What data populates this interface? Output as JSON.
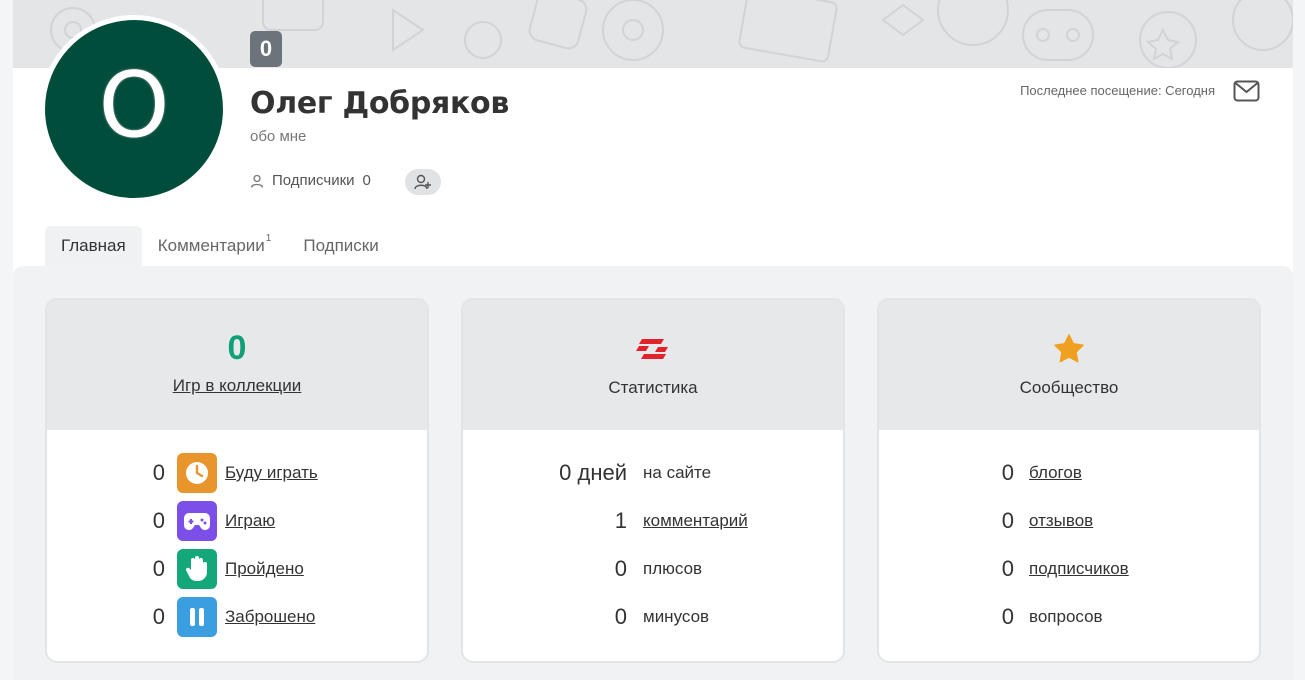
{
  "profile": {
    "avatar_letter": "O",
    "level": "0",
    "name": "Олег Добряков",
    "about": "обо мне",
    "followers_label": "Подписчики",
    "followers_count": "0",
    "last_visit": "Последнее посещение: Сегодня"
  },
  "tabs": [
    {
      "label": "Главная",
      "sup": ""
    },
    {
      "label": "Комментарии",
      "sup": "1"
    },
    {
      "label": "Подписки",
      "sup": ""
    }
  ],
  "collection": {
    "total": "0",
    "title": "Игр в коллекции",
    "items": [
      {
        "count": "0",
        "label": "Буду играть",
        "icon": "clock-icon",
        "color": "#e8962c"
      },
      {
        "count": "0",
        "label": "Играю",
        "icon": "gamepad-icon",
        "color": "#7b4fe8"
      },
      {
        "count": "0",
        "label": "Пройдено",
        "icon": "hand-icon",
        "color": "#14a77a"
      },
      {
        "count": "0",
        "label": "Заброшено",
        "icon": "pause-icon",
        "color": "#3a9ee0"
      }
    ]
  },
  "stats": {
    "title": "Статистика",
    "icon": "stopgame-logo-icon",
    "items": [
      {
        "count": "0 дней",
        "label": "на сайте"
      },
      {
        "count": "1",
        "label": "комментарий"
      },
      {
        "count": "0",
        "label": "плюсов"
      },
      {
        "count": "0",
        "label": "минусов"
      }
    ]
  },
  "community": {
    "title": "Сообщество",
    "icon": "star-icon",
    "items": [
      {
        "count": "0",
        "label": "блогов"
      },
      {
        "count": "0",
        "label": "отзывов"
      },
      {
        "count": "0",
        "label": "подписчиков"
      },
      {
        "count": "0",
        "label": "вопросов"
      }
    ]
  },
  "colors": {
    "avatar_bg": "#004d3b",
    "accent_green": "#0ea176",
    "stats_red": "#e3232c",
    "star_orange": "#f0a020"
  }
}
